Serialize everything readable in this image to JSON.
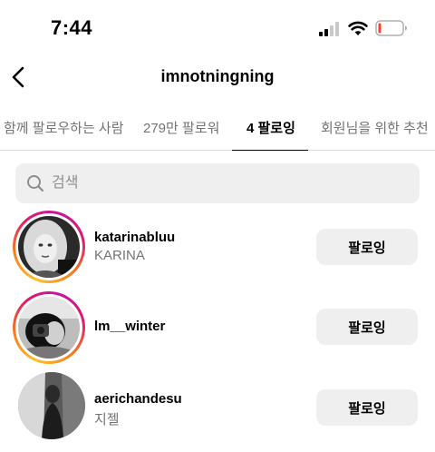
{
  "status_bar": {
    "time": "7:44",
    "signal_icon": "cellular-signal-icon",
    "wifi_icon": "wifi-icon",
    "battery_icon": "battery-low-icon",
    "battery_color": "#ff3b30"
  },
  "header": {
    "back_icon": "chevron-left-icon",
    "title": "imnotningning"
  },
  "tabs": [
    {
      "label": "함께 팔로우하는 사람",
      "active": false
    },
    {
      "label": "279만 팔로워",
      "active": false
    },
    {
      "label": "4 팔로잉",
      "active": true
    },
    {
      "label": "회원님을 위한 추천",
      "active": false
    }
  ],
  "search": {
    "icon": "search-icon",
    "placeholder": "검색"
  },
  "following": [
    {
      "username": "katarinabluu",
      "full_name": "KARINA",
      "button_label": "팔로잉",
      "story_ring": true
    },
    {
      "username": "lm__winter",
      "full_name": "",
      "button_label": "팔로잉",
      "story_ring": true
    },
    {
      "username": "aerichandesu",
      "full_name": "지젤",
      "button_label": "팔로잉",
      "story_ring": false
    }
  ],
  "colors": {
    "secondary_text": "#737373",
    "button_bg": "#efefef",
    "ring_gradient": [
      "#fdc12a",
      "#f77e1c",
      "#e2196a",
      "#c5159d"
    ]
  }
}
